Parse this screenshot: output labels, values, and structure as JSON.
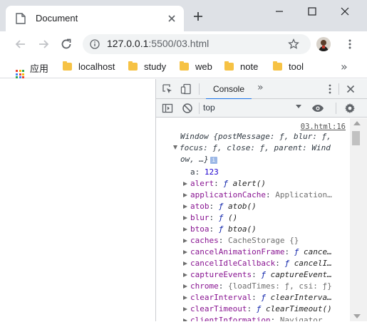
{
  "tab": {
    "title": "Document",
    "icon": "document-icon"
  },
  "address": {
    "host": "127.0.0.1",
    "rest": ":5500/03.html"
  },
  "bookmarks": {
    "apps_label": "应用",
    "items": [
      {
        "label": "localhost"
      },
      {
        "label": "study"
      },
      {
        "label": "web"
      },
      {
        "label": "note"
      },
      {
        "label": "tool"
      }
    ],
    "more": "»"
  },
  "devtools": {
    "console_tab": "Console",
    "more_tabs": "»",
    "context": "top"
  },
  "console": {
    "source": "03.html:16",
    "window_lines": [
      "Window {postMessage: ƒ, blur: ƒ,",
      "focus: ƒ, close: ƒ, parent: Wind",
      "ow, …}"
    ],
    "info_badge": "i",
    "first_prop": {
      "key": "a",
      "value": "123"
    },
    "props": [
      {
        "key": "alert",
        "kind": "fn",
        "value": "alert()"
      },
      {
        "key": "applicationCache",
        "kind": "obj",
        "value": "Application…"
      },
      {
        "key": "atob",
        "kind": "fn",
        "value": "atob()"
      },
      {
        "key": "blur",
        "kind": "fn",
        "value": "()"
      },
      {
        "key": "btoa",
        "kind": "fn",
        "value": "btoa()"
      },
      {
        "key": "caches",
        "kind": "obj",
        "value": "CacheStorage {}"
      },
      {
        "key": "cancelAnimationFrame",
        "kind": "fn",
        "value": "cance…"
      },
      {
        "key": "cancelIdleCallback",
        "kind": "fn",
        "value": "cancelI…"
      },
      {
        "key": "captureEvents",
        "kind": "fn",
        "value": "captureEvent…"
      },
      {
        "key": "chrome",
        "kind": "obj",
        "value": "{loadTimes: ƒ, csi: ƒ}"
      },
      {
        "key": "clearInterval",
        "kind": "fn",
        "value": "clearInterva…"
      },
      {
        "key": "clearTimeout",
        "kind": "fn",
        "value": "clearTimeout()"
      },
      {
        "key": "clientInformation",
        "kind": "obj",
        "value": "Navigator …"
      }
    ]
  },
  "colors": {
    "tab_strip": "#dee1e6",
    "accent": "#1a73e8",
    "key_purple": "#881391",
    "number_blue": "#1c00cf",
    "folder_yellow": "#f6c244"
  }
}
